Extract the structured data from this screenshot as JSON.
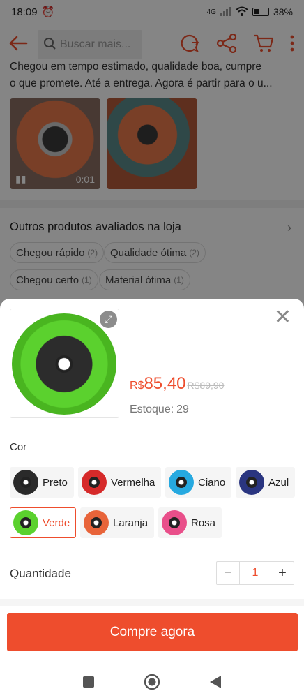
{
  "status_bar": {
    "time": "18:09",
    "network": "4G",
    "battery": "38%"
  },
  "search": {
    "placeholder": "Buscar mais..."
  },
  "review": {
    "line1": "Chegou em tempo estimado, qualidade boa, cumpre",
    "line2": "o que promete. Até a entrega. Agora é partir para o u...",
    "video_duration": "0:01"
  },
  "other_products": {
    "title": "Outros produtos avaliados na loja",
    "tags": [
      {
        "label": "Chegou rápido",
        "count": "(2)"
      },
      {
        "label": "Qualidade ótima",
        "count": "(2)"
      },
      {
        "label": "Chegou certo",
        "count": "(1)"
      },
      {
        "label": "Material ótima",
        "count": "(1)"
      }
    ]
  },
  "sheet": {
    "currency": "R$",
    "price": "85,40",
    "old_price": "R$89,90",
    "stock_label": "Estoque:",
    "stock_value": "29",
    "color_label": "Cor",
    "options": [
      {
        "label": "Preto",
        "color": "#2a2a2a"
      },
      {
        "label": "Vermelha",
        "color": "#d62a2a"
      },
      {
        "label": "Ciano",
        "color": "#26a9e0"
      },
      {
        "label": "Azul",
        "color": "#2a3580"
      },
      {
        "label": "Verde",
        "color": "#5bd12e"
      },
      {
        "label": "Laranja",
        "color": "#e8643a"
      },
      {
        "label": "Rosa",
        "color": "#e94f8a"
      }
    ],
    "selected_option": "Verde",
    "quantity_label": "Quantidade",
    "quantity_value": "1",
    "minus": "−",
    "plus": "+",
    "buy_label": "Compre agora"
  },
  "colors": {
    "accent": "#ee4d2d"
  }
}
